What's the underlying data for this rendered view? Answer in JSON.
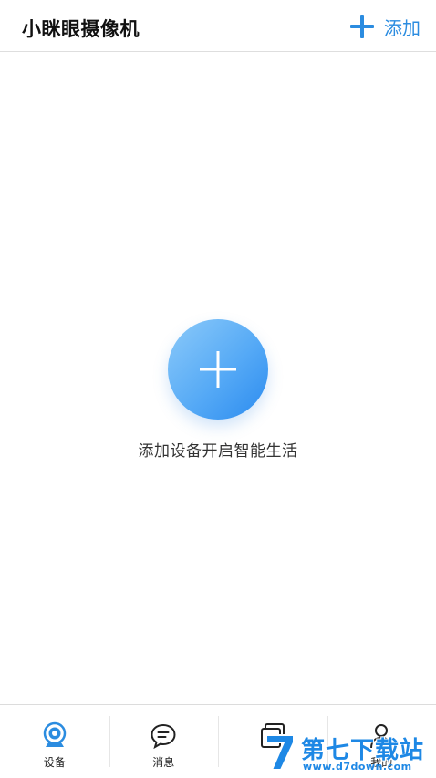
{
  "header": {
    "title": "小眯眼摄像机",
    "add_label": "添加",
    "accent_color": "#2b8ce0"
  },
  "empty_state": {
    "button_icon": "plus-icon",
    "message": "添加设备开启智能生活"
  },
  "tabbar": {
    "tabs": [
      {
        "label": "设备",
        "icon": "camera-icon",
        "active": true
      },
      {
        "label": "消息",
        "icon": "message-icon",
        "active": false
      },
      {
        "label": "",
        "icon": "cards-icon",
        "active": false
      },
      {
        "label": "我的",
        "icon": "person-icon",
        "active": false
      }
    ]
  },
  "watermark": {
    "title": "第七下载站",
    "url": "www.d7down.com"
  }
}
